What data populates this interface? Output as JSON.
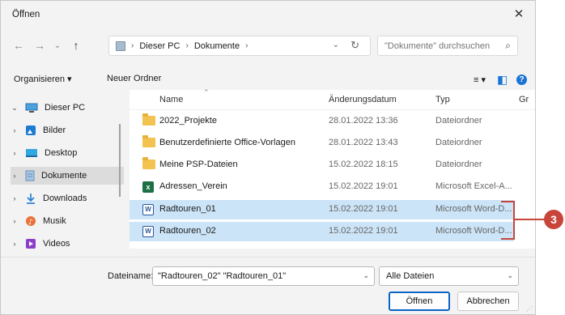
{
  "window": {
    "title": "Öffnen",
    "close": "✕"
  },
  "nav": {
    "back": "←",
    "forward": "→",
    "recent": "⌄",
    "up": "↑"
  },
  "address": {
    "root": "Dieser PC",
    "folder": "Dokumente",
    "sep": "›"
  },
  "search": {
    "placeholder": "\"Dokumente\" durchsuchen"
  },
  "toolbar": {
    "organize": "Organisieren ▾",
    "new_folder": "Neuer Ordner",
    "view": "≡ ▾",
    "pane": "◧",
    "help": "?"
  },
  "sidebar": {
    "items": [
      {
        "label": "Dieser PC",
        "chevron": "⌄"
      },
      {
        "label": "Bilder",
        "chevron": "›"
      },
      {
        "label": "Desktop",
        "chevron": "›"
      },
      {
        "label": "Dokumente",
        "chevron": "›"
      },
      {
        "label": "Downloads",
        "chevron": "›"
      },
      {
        "label": "Musik",
        "chevron": "›"
      },
      {
        "label": "Videos",
        "chevron": "›"
      }
    ]
  },
  "columns": {
    "name": "Name",
    "date": "Änderungsdatum",
    "type": "Typ",
    "size": "Gr"
  },
  "files": [
    {
      "name": "2022_Projekte",
      "date": "28.01.2022 13:36",
      "type": "Dateiordner",
      "icon": "folder"
    },
    {
      "name": "Benutzerdefinierte Office-Vorlagen",
      "date": "28.01.2022 13:43",
      "type": "Dateiordner",
      "icon": "folder"
    },
    {
      "name": "Meine PSP-Dateien",
      "date": "15.02.2022 18:15",
      "type": "Dateiordner",
      "icon": "folder"
    },
    {
      "name": "Adressen_Verein",
      "date": "15.02.2022 19:01",
      "type": "Microsoft Excel-A...",
      "icon": "excel"
    },
    {
      "name": "Radtouren_01",
      "date": "15.02.2022 19:01",
      "type": "Microsoft Word-D...",
      "icon": "word"
    },
    {
      "name": "Radtouren_02",
      "date": "15.02.2022 19:01",
      "type": "Microsoft Word-D...",
      "icon": "word"
    }
  ],
  "bottom": {
    "filename_label": "Dateiname:",
    "filename_value": "\"Radtouren_02\" \"Radtouren_01\"",
    "filter": "Alle Dateien",
    "open": "Öffnen",
    "cancel": "Abbrechen"
  },
  "callout": {
    "number": "3"
  },
  "colors": {
    "accent": "#0a64c8",
    "selection": "#cce4f7",
    "callout": "#c8453b"
  }
}
